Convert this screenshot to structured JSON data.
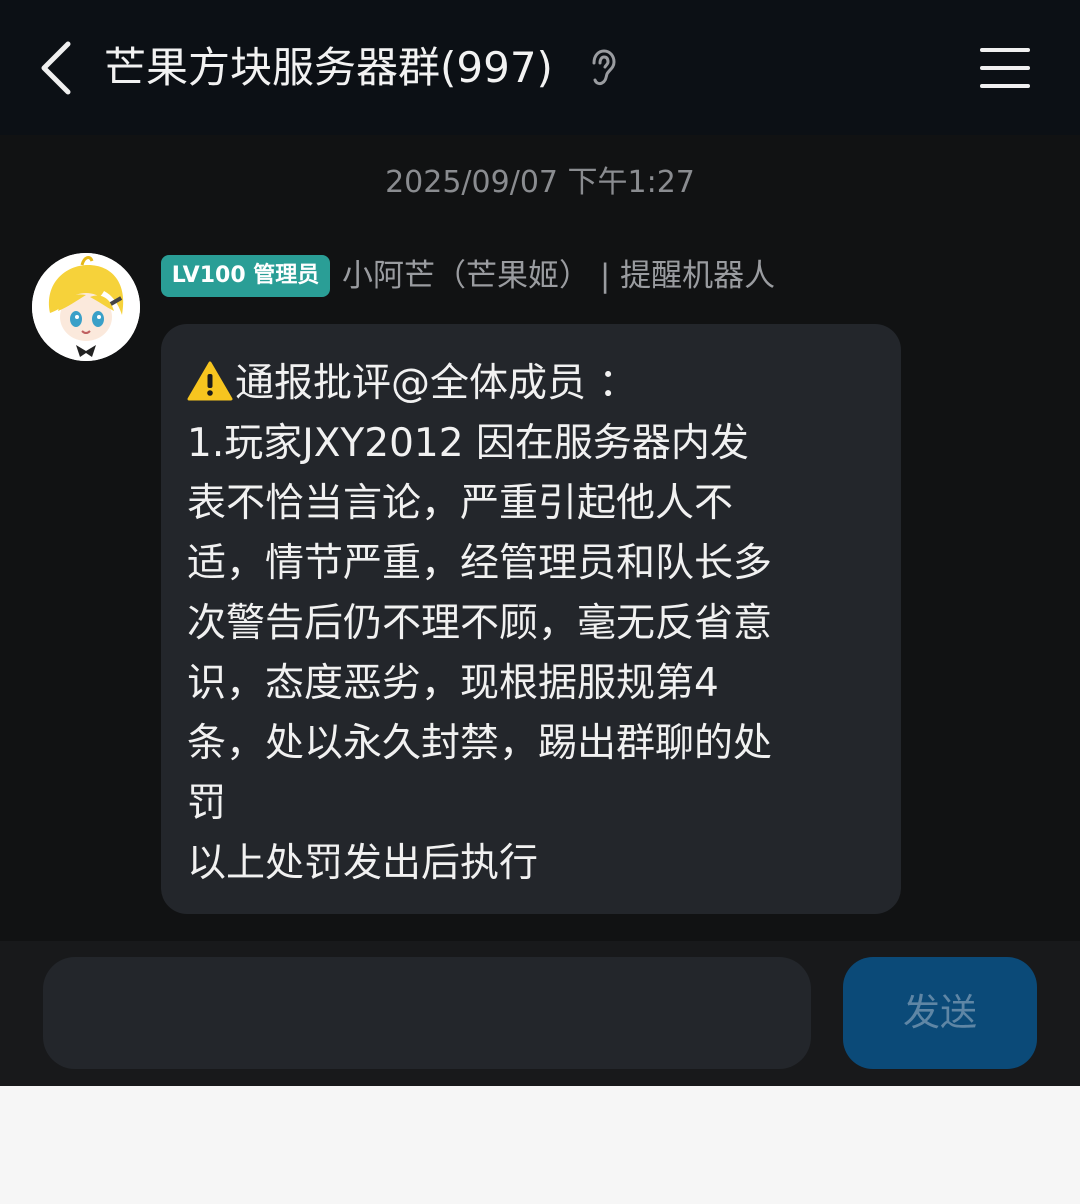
{
  "header": {
    "title": "芒果方块服务器群(997)",
    "back_icon": "chevron-left-icon",
    "ear_icon": "ear-icon",
    "menu_icon": "hamburger-menu-icon"
  },
  "chat": {
    "timestamp": "2025/09/07 下午1:27",
    "message": {
      "badge": "LV100 管理员",
      "sender": "小阿芒（芒果姬） | 提醒机器人",
      "warning_icon": "warning-icon",
      "lines": [
        "通报批评@全体成员 ：",
        "1.玩家JXY2012 因在服务器内发",
        "表不恰当言论，严重引起他人不",
        "适，情节严重，经管理员和队长多",
        "次警告后仍不理不顾，毫无反省意",
        "识，态度恶劣，现根据服规第4",
        "条，处以永久封禁，踢出群聊的处",
        "罚",
        "以上处罚发出后执行"
      ]
    }
  },
  "input_bar": {
    "input_value": "",
    "send_label": "发送"
  },
  "colors": {
    "header_bg": "#0c1015",
    "chat_bg": "#111213",
    "bubble_bg": "#23262b",
    "badge_bg": "#2a9e96",
    "send_bg": "#0b4a78"
  }
}
